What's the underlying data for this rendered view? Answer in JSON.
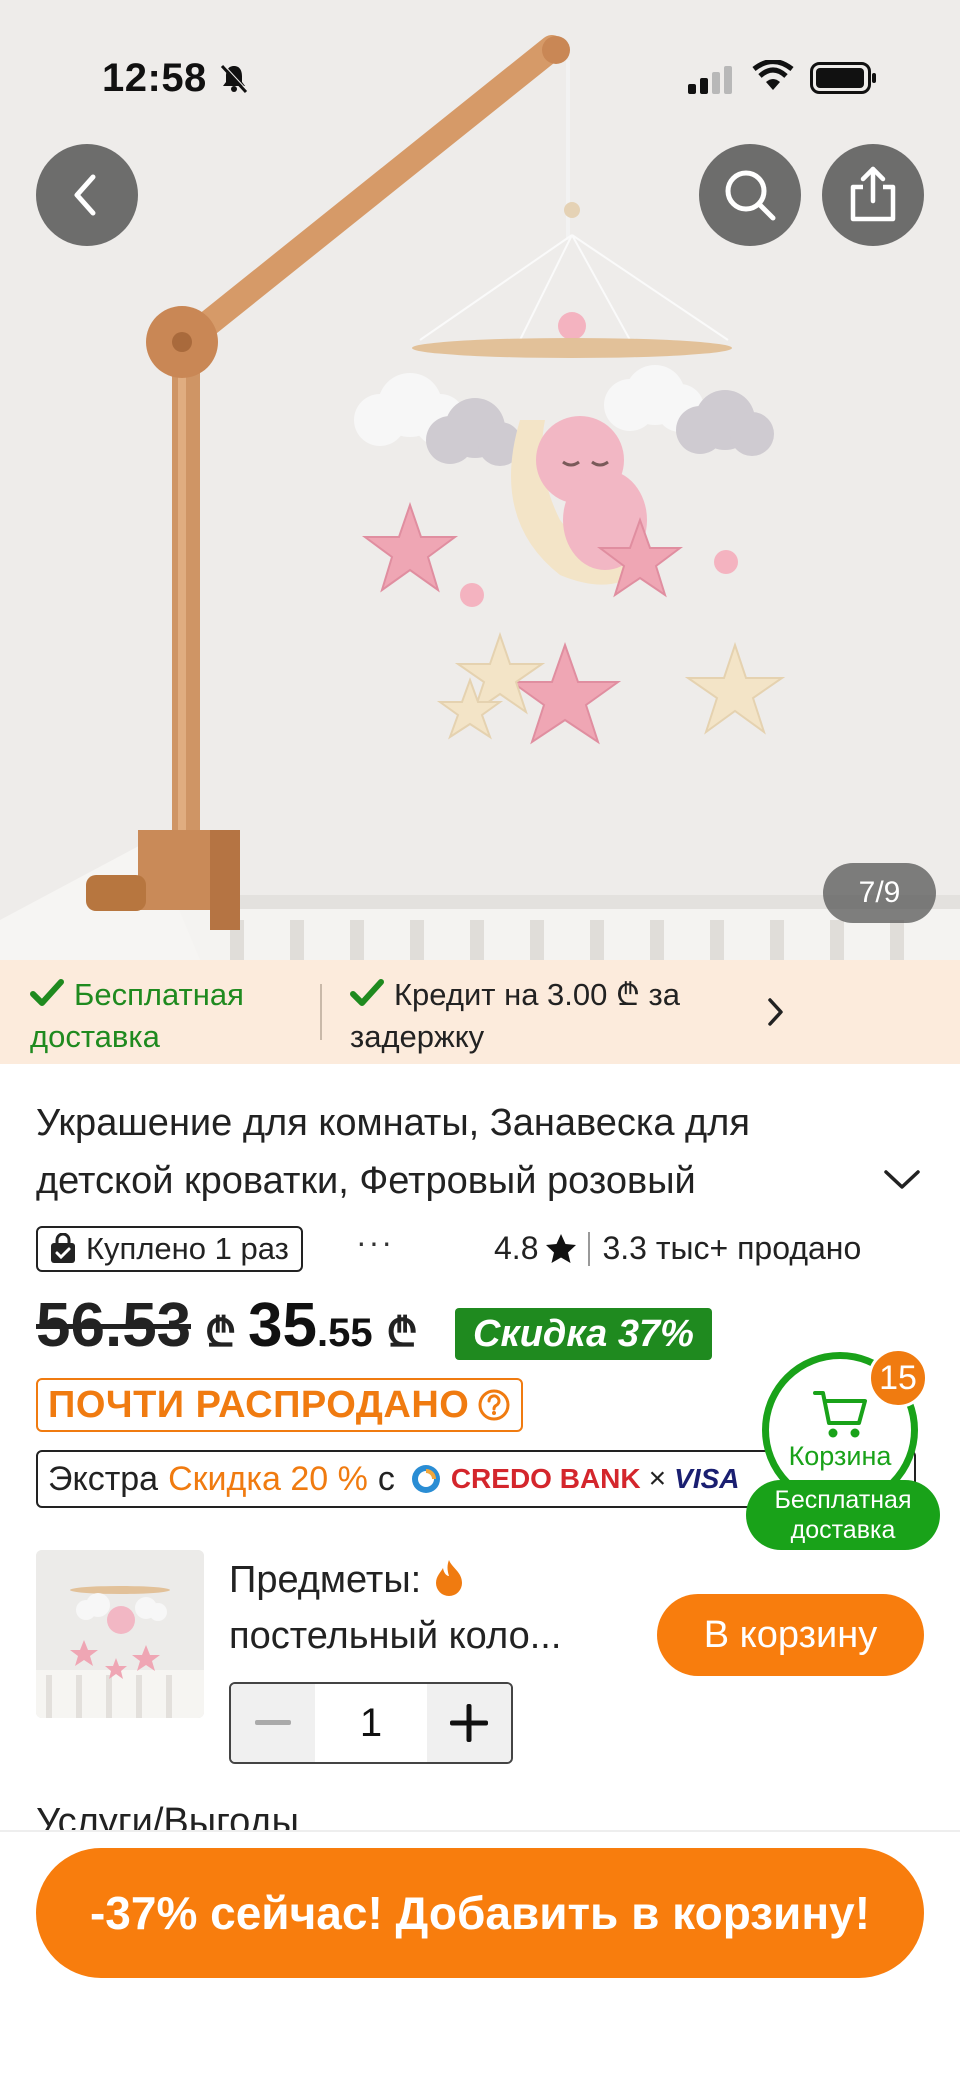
{
  "status_bar": {
    "time": "12:58"
  },
  "gallery": {
    "counter": "7/9"
  },
  "benefits": {
    "free_shipping": "Бесплатная доставка",
    "credit": "Кредит на 3.00 ₾ за задержку"
  },
  "product": {
    "title": "Украшение для комнаты, Занавеска для детской кроватки, Фетровый розовый",
    "bought_badge": "Куплено 1 раз",
    "more": "···",
    "rating": "4.8",
    "sold": "3.3 тыс+ продано",
    "old_price": "56.53",
    "currency": "₾",
    "price_int": "35",
    "price_dec": ".55",
    "discount": "Скидка 37%",
    "almost_sold_out": "ПОЧТИ РАСПРОДАНО"
  },
  "extra_discount": {
    "prefix": "Экстра",
    "highlight": "Скидка 20 %",
    "with": "с",
    "bank": "CREDO BANK",
    "times": "×",
    "card": "VISA"
  },
  "cart_float": {
    "label": "Корзина",
    "count": "15",
    "free_shipping": "Бесплатная доставка"
  },
  "sku": {
    "label_line1": "Предметы:",
    "label_line2": "постельный коло...",
    "add_button": "В корзину",
    "quantity": "1"
  },
  "sections": {
    "services": "Услуги/Выгоды"
  },
  "cta": {
    "label": "-37% сейчас! Добавить в корзину!"
  },
  "colors": {
    "accent_orange": "#f87d0d",
    "accent_green": "#1f8a1f",
    "benefits_bg": "#fcebdc"
  }
}
